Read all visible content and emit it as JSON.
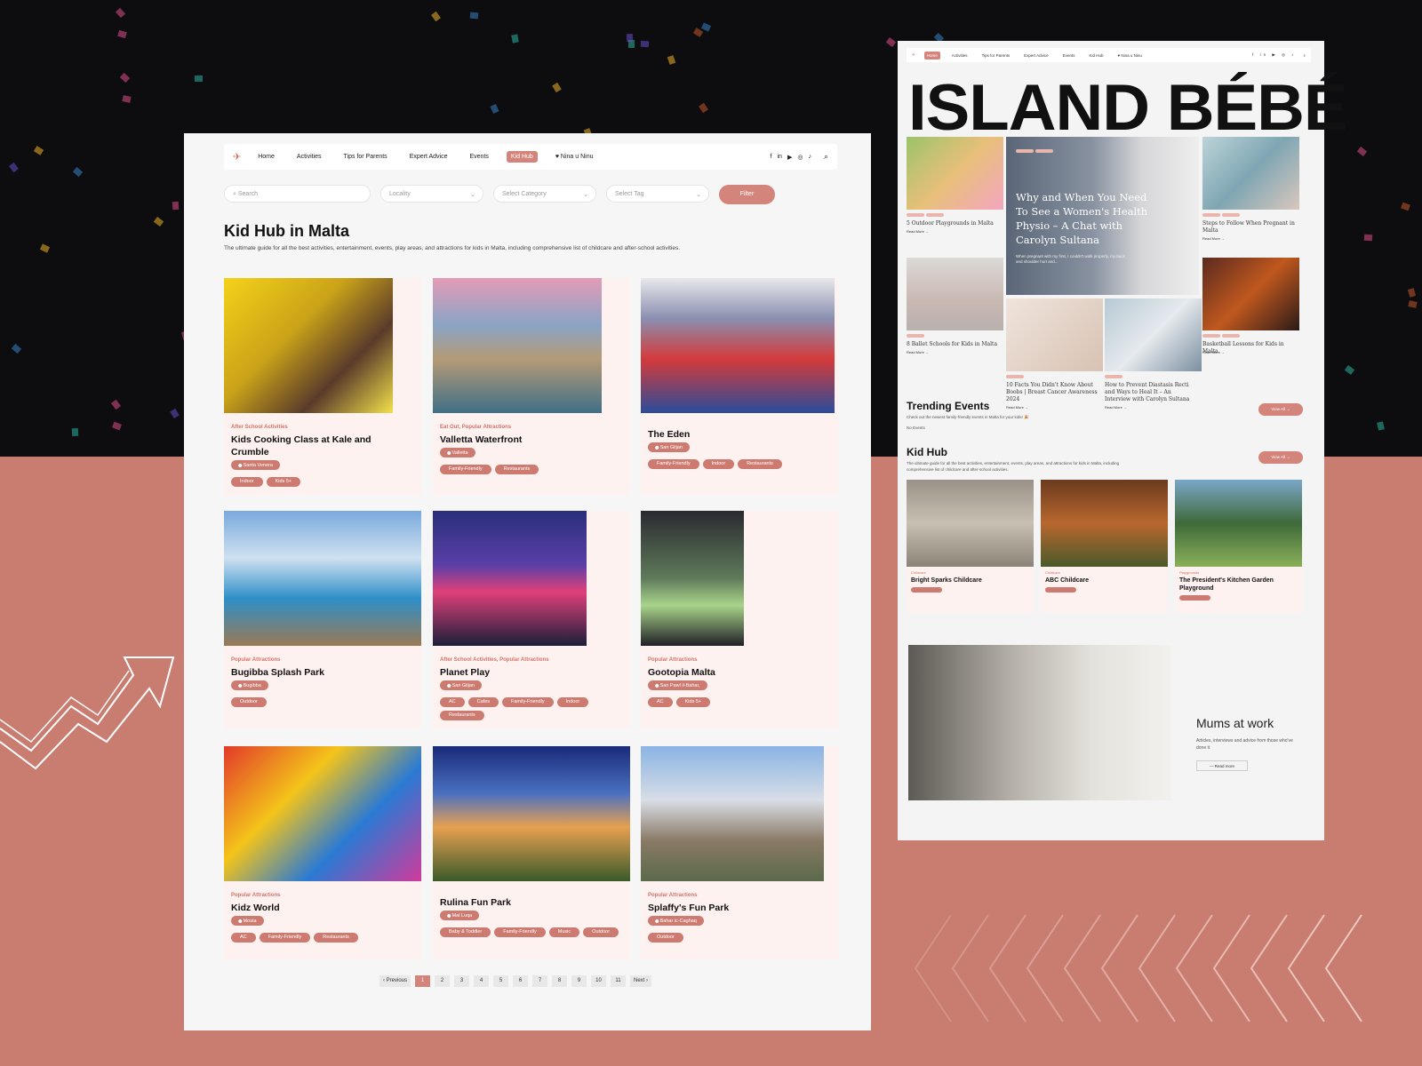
{
  "left": {
    "nav": {
      "items": [
        "Home",
        "Activities",
        "Tips for Parents",
        "Expert Advice",
        "Events",
        "Kid Hub"
      ],
      "active": "Kid Hub",
      "nina": "Nina u Ninu"
    },
    "filters": {
      "search": "Search",
      "locality": "Locality",
      "category": "Select Category",
      "tag": "Select Tag",
      "button": "Filter"
    },
    "title": "Kid Hub in Malta",
    "description": "The ultimate guide for all the best activities, entertainment, events, play areas, and attractions for kids in Malta, including comprehensive list of childcare and after-school activities.",
    "cards": [
      {
        "category": "After School Activities",
        "name": "Kids Cooking Class at Kale and Crumble",
        "location": "Santa Venera",
        "tags": [
          "Indoor",
          "Kids 5+"
        ]
      },
      {
        "category": "Eat Out, Popular Attractions",
        "name": "Valletta Waterfront",
        "location": "Valletta",
        "tags": [
          "Family-Friendly",
          "Restaurants"
        ]
      },
      {
        "category": "",
        "name": "The Eden",
        "location": "San Giljan",
        "tags": [
          "Family-Friendly",
          "Indoor",
          "Restaurants"
        ]
      },
      {
        "category": "Popular Attractions",
        "name": "Bugibba Splash Park",
        "location": "Bugibba",
        "tags": [
          "Outdoor"
        ]
      },
      {
        "category": "After School Activities, Popular Attractions",
        "name": "Planet Play",
        "location": "San Giljan",
        "tags": [
          "AC",
          "Cafes",
          "Family-Friendly",
          "Indoor",
          "Restaurants"
        ]
      },
      {
        "category": "Popular Attractions",
        "name": "Gootopia Malta",
        "location": "San Pawl il-Bahar,",
        "tags": [
          "AC",
          "Kids 5+"
        ]
      },
      {
        "category": "Popular Attractions",
        "name": "Kidz World",
        "location": "Mosta",
        "tags": [
          "AC",
          "Family-Friendly",
          "Restaurants"
        ]
      },
      {
        "category": "",
        "name": "Rulina Fun Park",
        "location": "Mal Luqa",
        "tags": [
          "Baby & Toddler",
          "Family-Friendly",
          "Music",
          "Outdoor"
        ]
      },
      {
        "category": "Popular Attractions",
        "name": "Splaffy's Fun Park",
        "location": "Bahar ic-Caghaq",
        "tags": [
          "Outdoor"
        ]
      }
    ],
    "pagination": [
      "‹ Previous",
      "1",
      "2",
      "3",
      "4",
      "5",
      "6",
      "7",
      "8",
      "9",
      "10",
      "11",
      "Next ›"
    ]
  },
  "right": {
    "nav": {
      "items": [
        "Home",
        "Activities",
        "Tips for Parents",
        "Expert Advice",
        "Events",
        "Kid Hub"
      ],
      "nina": "Nina u Ninu"
    },
    "brand": "ISLAND BÉBÉ",
    "headline": "Why and When You Need To See a Women's Health Physio – A Chat with Carolyn Sultana",
    "headline_sub": "When pregnant with my first, I couldn't walk properly, my back and shoulder hurt and...",
    "articles": [
      "5 Outdoor Playgrounds in Malta",
      "Steps to Follow When Pregnant in Malta",
      "8 Ballet Schools for Kids in Malta",
      "10 Facts You Didn't Know About Boobs | Breast Cancer Awareness 2024",
      "How to Prevent Diastasis Recti and Ways to Heal It – An Interview with Carolyn Sultana",
      "Basketball Lessons for Kids in Malta"
    ],
    "read_more": "Read More →",
    "trending": {
      "title": "Trending Events",
      "desc": "Check out the newest family-friendly events in Malta for your kids! 🎉",
      "empty": "No Events",
      "view": "View All →"
    },
    "kidhub": {
      "title": "Kid Hub",
      "desc": "The ultimate guide for all the best activities, entertainment, events, play areas, and attractions for kids in Malta, including comprehensive list of childcare and after-school activities.",
      "view": "View All →",
      "cards": [
        {
          "cat": "Childcare",
          "name": "Bright Sparks Childcare"
        },
        {
          "cat": "Childcare",
          "name": "ABC Childcare"
        },
        {
          "cat": "Playgrounds",
          "name": "The President's Kitchen Garden Playground"
        }
      ]
    },
    "mums": {
      "title": "Mums at work",
      "desc": "Articles, interviews and advice from those who've done it",
      "btn": "—  Read more"
    }
  },
  "colors": {
    "accent": "#d4857b",
    "dark": "#0d0d0f",
    "coral": "#c97c70"
  }
}
